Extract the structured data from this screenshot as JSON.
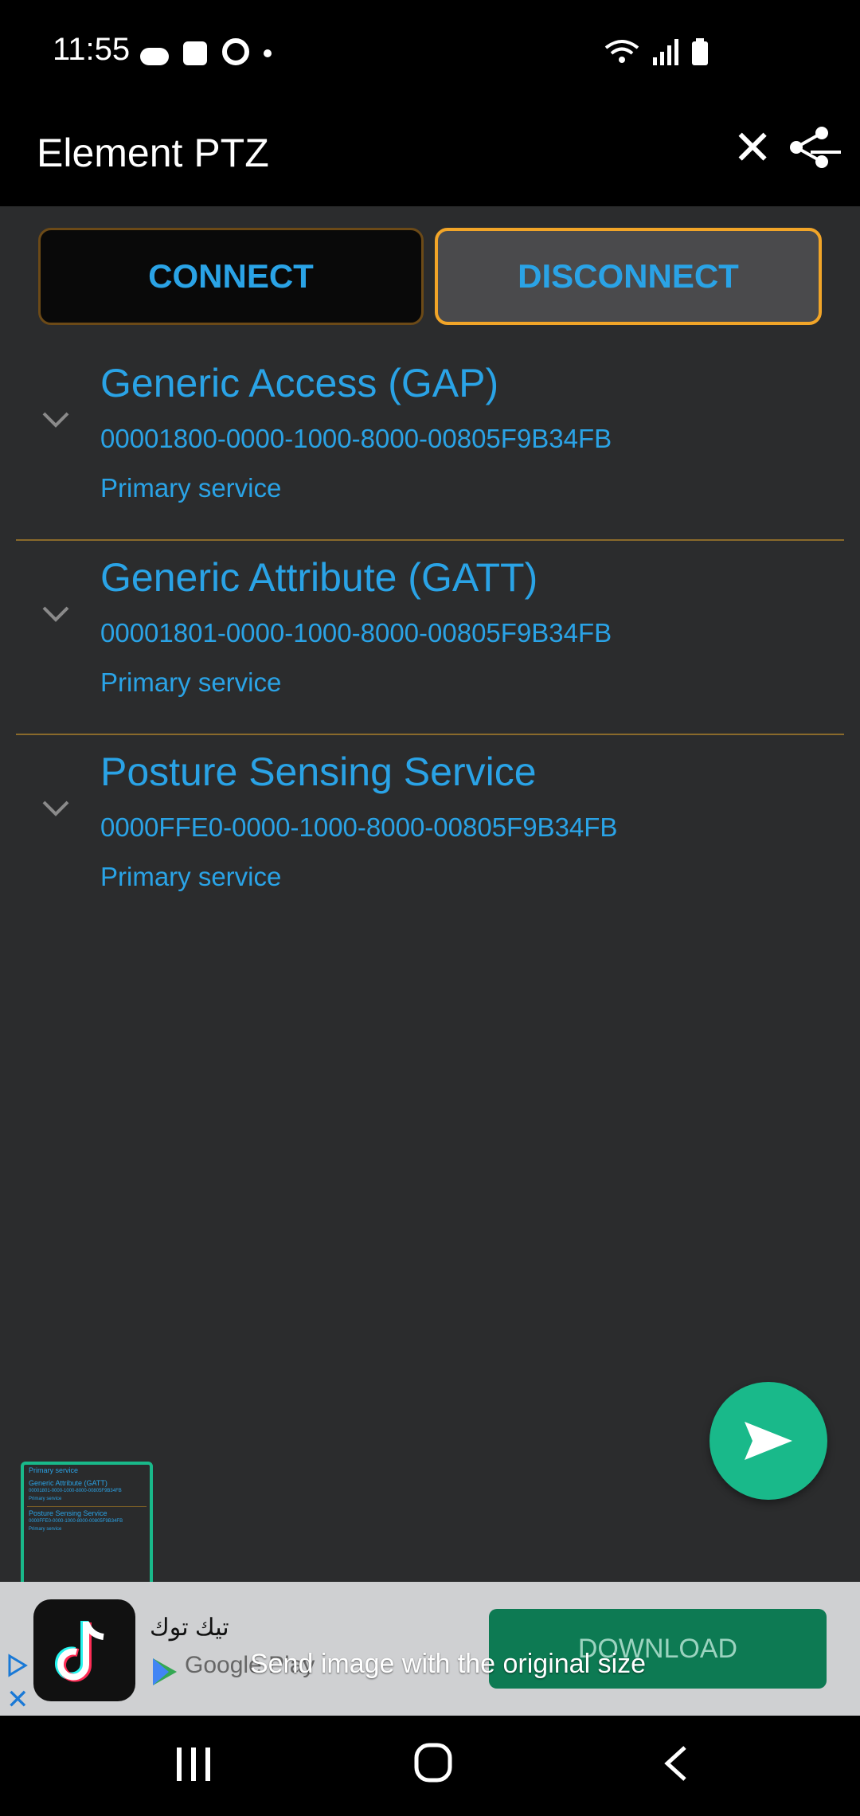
{
  "status_bar": {
    "time": "11:55",
    "icons": [
      "cloud-icon",
      "gallery-icon",
      "pin-icon",
      "dot-icon",
      "wifi-icon",
      "signal-icon",
      "battery-icon"
    ]
  },
  "toolbar": {
    "title": "Element PTZ",
    "close_glyph": "✕",
    "share_icon": "share-icon"
  },
  "buttons": {
    "connect": "CONNECT",
    "disconnect": "DISCONNECT"
  },
  "services": [
    {
      "name": "Generic Access (GAP)",
      "uuid": "00001800-0000-1000-8000-00805F9B34FB",
      "type": "Primary service"
    },
    {
      "name": "Generic Attribute (GATT)",
      "uuid": "00001801-0000-1000-8000-00805F9B34FB",
      "type": "Primary service"
    },
    {
      "name": "Posture Sensing Service",
      "uuid": "0000FFE0-0000-1000-8000-00805F9B34FB",
      "type": "Primary service"
    }
  ],
  "thumbnail": {
    "lines": [
      "Primary service",
      "Generic Attribute (GATT)",
      "00001801-0000-1000-8000-00805F9B34FB",
      "Primary service",
      "Posture Sensing Service",
      "0000FFE0-0000-1000-8000-00805F9B34FB",
      "Primary service"
    ]
  },
  "ad": {
    "app_name": "تيك توك",
    "store": "Google Play",
    "download": "DOWNLOAD",
    "caption": "Send image with the original size",
    "close_glyph": "✕"
  },
  "colors": {
    "accent": "#2aa3e6",
    "fab": "#19b98a",
    "divider": "#8a6a2b",
    "highlight_border": "#f2a528"
  }
}
